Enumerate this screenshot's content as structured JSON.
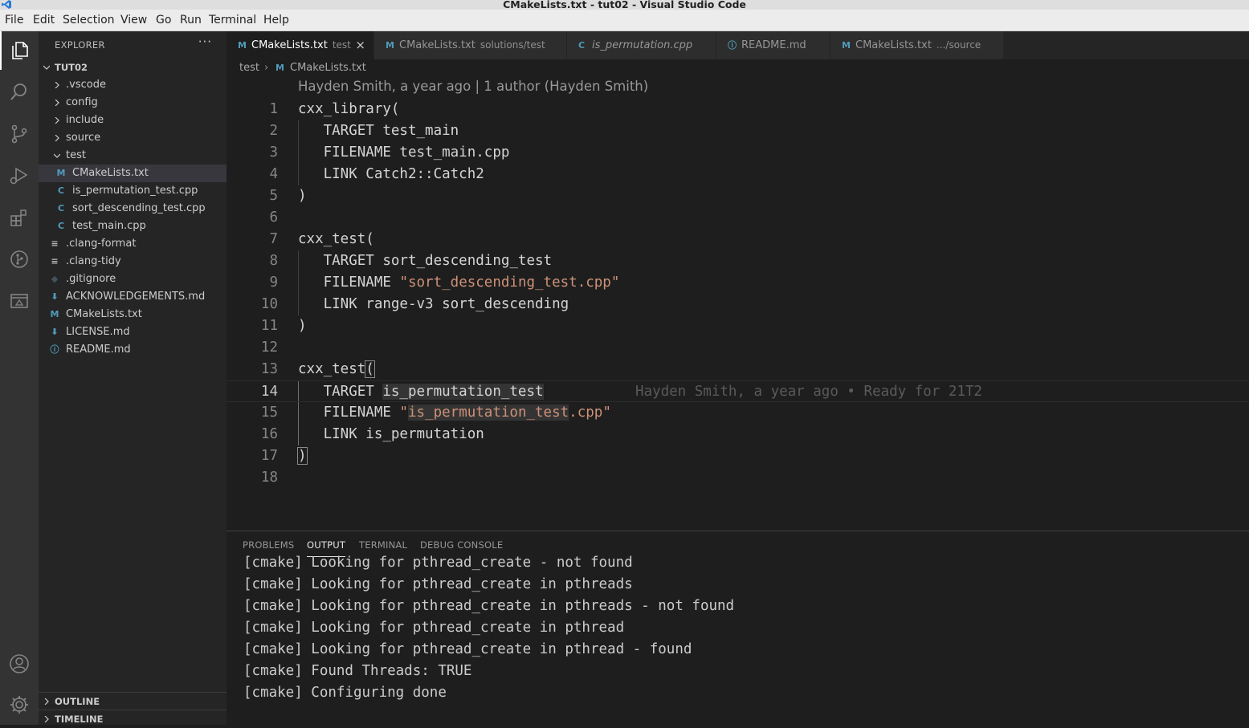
{
  "window": {
    "title": "CMakeLists.txt - tut02 - Visual Studio Code"
  },
  "menu": [
    "File",
    "Edit",
    "Selection",
    "View",
    "Go",
    "Run",
    "Terminal",
    "Help"
  ],
  "activity_bar": {
    "items": [
      "explorer-icon",
      "search-icon",
      "source-control-icon",
      "run-debug-icon",
      "extensions-icon",
      "git-graph-icon",
      "remote-explorer-icon"
    ],
    "bottom": [
      "account-icon",
      "manage-gear-icon"
    ]
  },
  "sidebar": {
    "header": "EXPLORER",
    "more": "···",
    "root": "TUT02",
    "tree": [
      {
        "label": ".vscode",
        "type": "folder",
        "expanded": false
      },
      {
        "label": "config",
        "type": "folder",
        "expanded": false
      },
      {
        "label": "include",
        "type": "folder",
        "expanded": false
      },
      {
        "label": "source",
        "type": "folder",
        "expanded": false
      },
      {
        "label": "test",
        "type": "folder",
        "expanded": true
      },
      {
        "label": "CMakeLists.txt",
        "type": "cmake",
        "selected": true
      },
      {
        "label": "is_permutation_test.cpp",
        "type": "cpp"
      },
      {
        "label": "sort_descending_test.cpp",
        "type": "cpp"
      },
      {
        "label": "test_main.cpp",
        "type": "cpp"
      },
      {
        "label": ".clang-format",
        "type": "text"
      },
      {
        "label": ".clang-tidy",
        "type": "text"
      },
      {
        "label": ".gitignore",
        "type": "git"
      },
      {
        "label": "ACKNOWLEDGEMENTS.md",
        "type": "md-download"
      },
      {
        "label": "CMakeLists.txt",
        "type": "cmake"
      },
      {
        "label": "LICENSE.md",
        "type": "md-download"
      },
      {
        "label": "README.md",
        "type": "info"
      }
    ],
    "outline": "OUTLINE",
    "timeline": "TIMELINE"
  },
  "tabs": [
    {
      "icon": "M",
      "name": "CMakeLists.txt",
      "desc": "test",
      "active": true,
      "close": "×"
    },
    {
      "icon": "M",
      "name": "CMakeLists.txt",
      "desc": "solutions/test"
    },
    {
      "icon": "C",
      "name": "is_permutation.cpp",
      "desc": ""
    },
    {
      "icon": "ⓘ",
      "name": "README.md",
      "desc": ""
    },
    {
      "icon": "M",
      "name": "CMakeLists.txt",
      "desc": ".../source"
    }
  ],
  "breadcrumb": {
    "folder": "test",
    "sep": "›",
    "file": "CMakeLists.txt"
  },
  "codelens": "Hayden Smith, a year ago | 1 author (Hayden Smith)",
  "code": [
    {
      "n": "1",
      "parts": [
        [
          "cxx_library(",
          ""
        ]
      ]
    },
    {
      "n": "2",
      "parts": [
        [
          "   TARGET test_main",
          ""
        ]
      ]
    },
    {
      "n": "3",
      "parts": [
        [
          "   FILENAME test_main.cpp",
          ""
        ]
      ]
    },
    {
      "n": "4",
      "parts": [
        [
          "   LINK Catch2::Catch2",
          ""
        ]
      ]
    },
    {
      "n": "5",
      "parts": [
        [
          ")",
          ""
        ]
      ]
    },
    {
      "n": "6",
      "parts": []
    },
    {
      "n": "7",
      "parts": [
        [
          "cxx_test(",
          ""
        ]
      ]
    },
    {
      "n": "8",
      "parts": [
        [
          "   TARGET sort_descending_test",
          ""
        ]
      ]
    },
    {
      "n": "9",
      "parts": [
        [
          "   FILENAME ",
          ""
        ],
        [
          "\"sort_descending_test.cpp\"",
          "str"
        ]
      ]
    },
    {
      "n": "10",
      "parts": [
        [
          "   LINK range-v3 sort_descending",
          ""
        ]
      ]
    },
    {
      "n": "11",
      "parts": [
        [
          ")",
          ""
        ]
      ]
    },
    {
      "n": "12",
      "parts": []
    },
    {
      "n": "13",
      "parts": [
        [
          "cxx_test",
          ""
        ],
        [
          "(",
          "bm"
        ]
      ]
    },
    {
      "n": "14",
      "current": true,
      "parts": [
        [
          "   TARGET ",
          ""
        ],
        [
          "is_permutation_test",
          "hl"
        ]
      ],
      "blame": "Hayden Smith, a year ago • Ready for 21T2"
    },
    {
      "n": "15",
      "parts": [
        [
          "   FILENAME ",
          ""
        ],
        [
          "\"",
          "str"
        ],
        [
          "is_permutation_test",
          "str hl"
        ],
        [
          ".cpp\"",
          "str"
        ]
      ]
    },
    {
      "n": "16",
      "parts": [
        [
          "   LINK is_permutation",
          ""
        ]
      ]
    },
    {
      "n": "17",
      "parts": [
        [
          ")",
          "bm"
        ]
      ]
    },
    {
      "n": "18",
      "parts": []
    }
  ],
  "panel": {
    "tabs": [
      "PROBLEMS",
      "OUTPUT",
      "TERMINAL",
      "DEBUG CONSOLE"
    ],
    "active_tab": "OUTPUT",
    "output": [
      "[cmake] Looking for pthread_create - not found",
      "[cmake] Looking for pthread_create in pthreads",
      "[cmake] Looking for pthread_create in pthreads - not found",
      "[cmake] Looking for pthread_create in pthread",
      "[cmake] Looking for pthread_create in pthread - found",
      "[cmake] Found Threads: TRUE",
      "[cmake] Configuring done"
    ]
  },
  "colors": {
    "cmake_icon": "#519aba",
    "cpp_icon": "#519aba",
    "git_icon": "#41535b",
    "md_icon": "#519aba",
    "string": "#ce9178"
  }
}
